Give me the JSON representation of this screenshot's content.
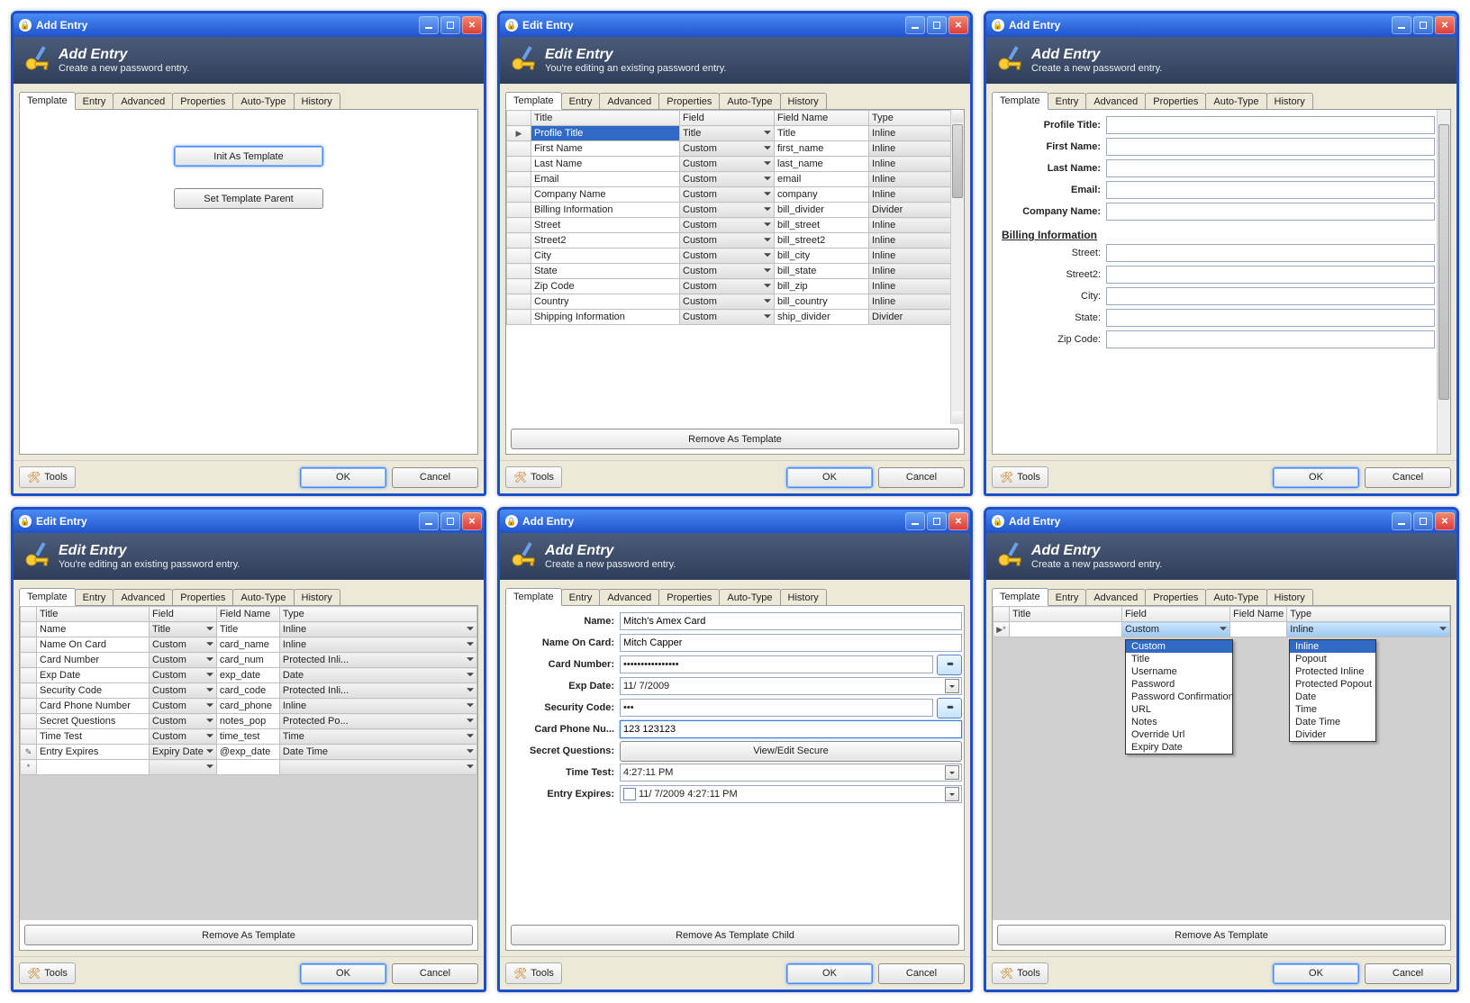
{
  "titlebar": {
    "add": "Add Entry",
    "edit": "Edit Entry"
  },
  "banner": {
    "add": {
      "title": "Add Entry",
      "sub": "Create a new password entry."
    },
    "edit": {
      "title": "Edit Entry",
      "sub": "You're editing an existing password entry."
    }
  },
  "tabs": [
    "Template",
    "Entry",
    "Advanced",
    "Properties",
    "Auto-Type",
    "History"
  ],
  "footer": {
    "tools": "Tools",
    "ok": "OK",
    "cancel": "Cancel"
  },
  "buttons": {
    "init_as_template": "Init As Template",
    "set_template_parent": "Set Template Parent",
    "remove_as_template": "Remove As Template",
    "remove_as_template_child": "Remove As Template Child",
    "view_edit_secure": "View/Edit Secure"
  },
  "grid_headers": {
    "title": "Title",
    "field": "Field",
    "field_name": "Field Name",
    "type": "Type"
  },
  "win2_rows": [
    {
      "title": "Profile Title",
      "field": "Title",
      "field_name": "Title",
      "type": "Inline",
      "sel": true,
      "marker": "▶"
    },
    {
      "title": "First Name",
      "field": "Custom",
      "field_name": "first_name",
      "type": "Inline"
    },
    {
      "title": "Last Name",
      "field": "Custom",
      "field_name": "last_name",
      "type": "Inline"
    },
    {
      "title": "Email",
      "field": "Custom",
      "field_name": "email",
      "type": "Inline"
    },
    {
      "title": "Company Name",
      "field": "Custom",
      "field_name": "company",
      "type": "Inline"
    },
    {
      "title": "Billing Information",
      "field": "Custom",
      "field_name": "bill_divider",
      "type": "Divider"
    },
    {
      "title": "Street",
      "field": "Custom",
      "field_name": "bill_street",
      "type": "Inline"
    },
    {
      "title": "Street2",
      "field": "Custom",
      "field_name": "bill_street2",
      "type": "Inline"
    },
    {
      "title": "City",
      "field": "Custom",
      "field_name": "bill_city",
      "type": "Inline"
    },
    {
      "title": "State",
      "field": "Custom",
      "field_name": "bill_state",
      "type": "Inline"
    },
    {
      "title": "Zip Code",
      "field": "Custom",
      "field_name": "bill_zip",
      "type": "Inline"
    },
    {
      "title": "Country",
      "field": "Custom",
      "field_name": "bill_country",
      "type": "Inline"
    },
    {
      "title": "Shipping Information",
      "field": "Custom",
      "field_name": "ship_divider",
      "type": "Divider"
    }
  ],
  "win3_form": {
    "fields": [
      {
        "label": "Profile Title:",
        "bold": true
      },
      {
        "label": "First Name:",
        "bold": true
      },
      {
        "label": "Last Name:",
        "bold": true
      },
      {
        "label": "Email:",
        "bold": true
      },
      {
        "label": "Company Name:",
        "bold": true
      }
    ],
    "section": "Billing Information",
    "fields2": [
      {
        "label": "Street:"
      },
      {
        "label": "Street2:"
      },
      {
        "label": "City:"
      },
      {
        "label": "State:"
      },
      {
        "label": "Zip Code:"
      }
    ]
  },
  "win4_rows": [
    {
      "title": "Name",
      "field": "Title",
      "field_name": "Title",
      "type": "Inline"
    },
    {
      "title": "Name On Card",
      "field": "Custom",
      "field_name": "card_name",
      "type": "Inline"
    },
    {
      "title": "Card Number",
      "field": "Custom",
      "field_name": "card_num",
      "type": "Protected Inli..."
    },
    {
      "title": "Exp Date",
      "field": "Custom",
      "field_name": "exp_date",
      "type": "Date"
    },
    {
      "title": "Security Code",
      "field": "Custom",
      "field_name": "card_code",
      "type": "Protected Inli..."
    },
    {
      "title": "Card Phone Number",
      "field": "Custom",
      "field_name": "card_phone",
      "type": "Inline"
    },
    {
      "title": "Secret Questions",
      "field": "Custom",
      "field_name": "notes_pop",
      "type": "Protected Po..."
    },
    {
      "title": "Time Test",
      "field": "Custom",
      "field_name": "time_test",
      "type": "Time"
    },
    {
      "title": "Entry Expires",
      "field": "Expiry Date",
      "field_name": "@exp_date",
      "type": "Date Time",
      "marker": "✎"
    }
  ],
  "win5_form": [
    {
      "label": "Name:",
      "value": "Mitch's Amex Card",
      "kind": "text",
      "bold": true
    },
    {
      "label": "Name On Card:",
      "value": "Mitch Capper",
      "kind": "text",
      "bold": true
    },
    {
      "label": "Card Number:",
      "value": "••••••••••••••••",
      "kind": "secure",
      "bold": true
    },
    {
      "label": "Exp Date:",
      "value": "11/ 7/2009",
      "kind": "date",
      "bold": true
    },
    {
      "label": "Security Code:",
      "value": "•••",
      "kind": "secure",
      "bold": true
    },
    {
      "label": "Card Phone Nu...",
      "value": "123 123123",
      "kind": "text",
      "bold": true,
      "active": true
    },
    {
      "label": "Secret Questions:",
      "kind": "button",
      "bold": true
    },
    {
      "label": "Time Test:",
      "value": "4:27:11 PM",
      "kind": "date",
      "bold": true
    },
    {
      "label": "Entry Expires:",
      "value": "11/ 7/2009   4:27:11 PM",
      "kind": "datetime",
      "bold": true
    }
  ],
  "win6": {
    "rowmarker": "▶*",
    "field_sel": "Custom",
    "type_sel": "Inline",
    "field_options": [
      "Custom",
      "Title",
      "Username",
      "Password",
      "Password Confirmation",
      "URL",
      "Notes",
      "Override Url",
      "Expiry Date"
    ],
    "type_options": [
      "Inline",
      "Popout",
      "Protected Inline",
      "Protected Popout",
      "Date",
      "Time",
      "Date Time",
      "Divider"
    ]
  }
}
